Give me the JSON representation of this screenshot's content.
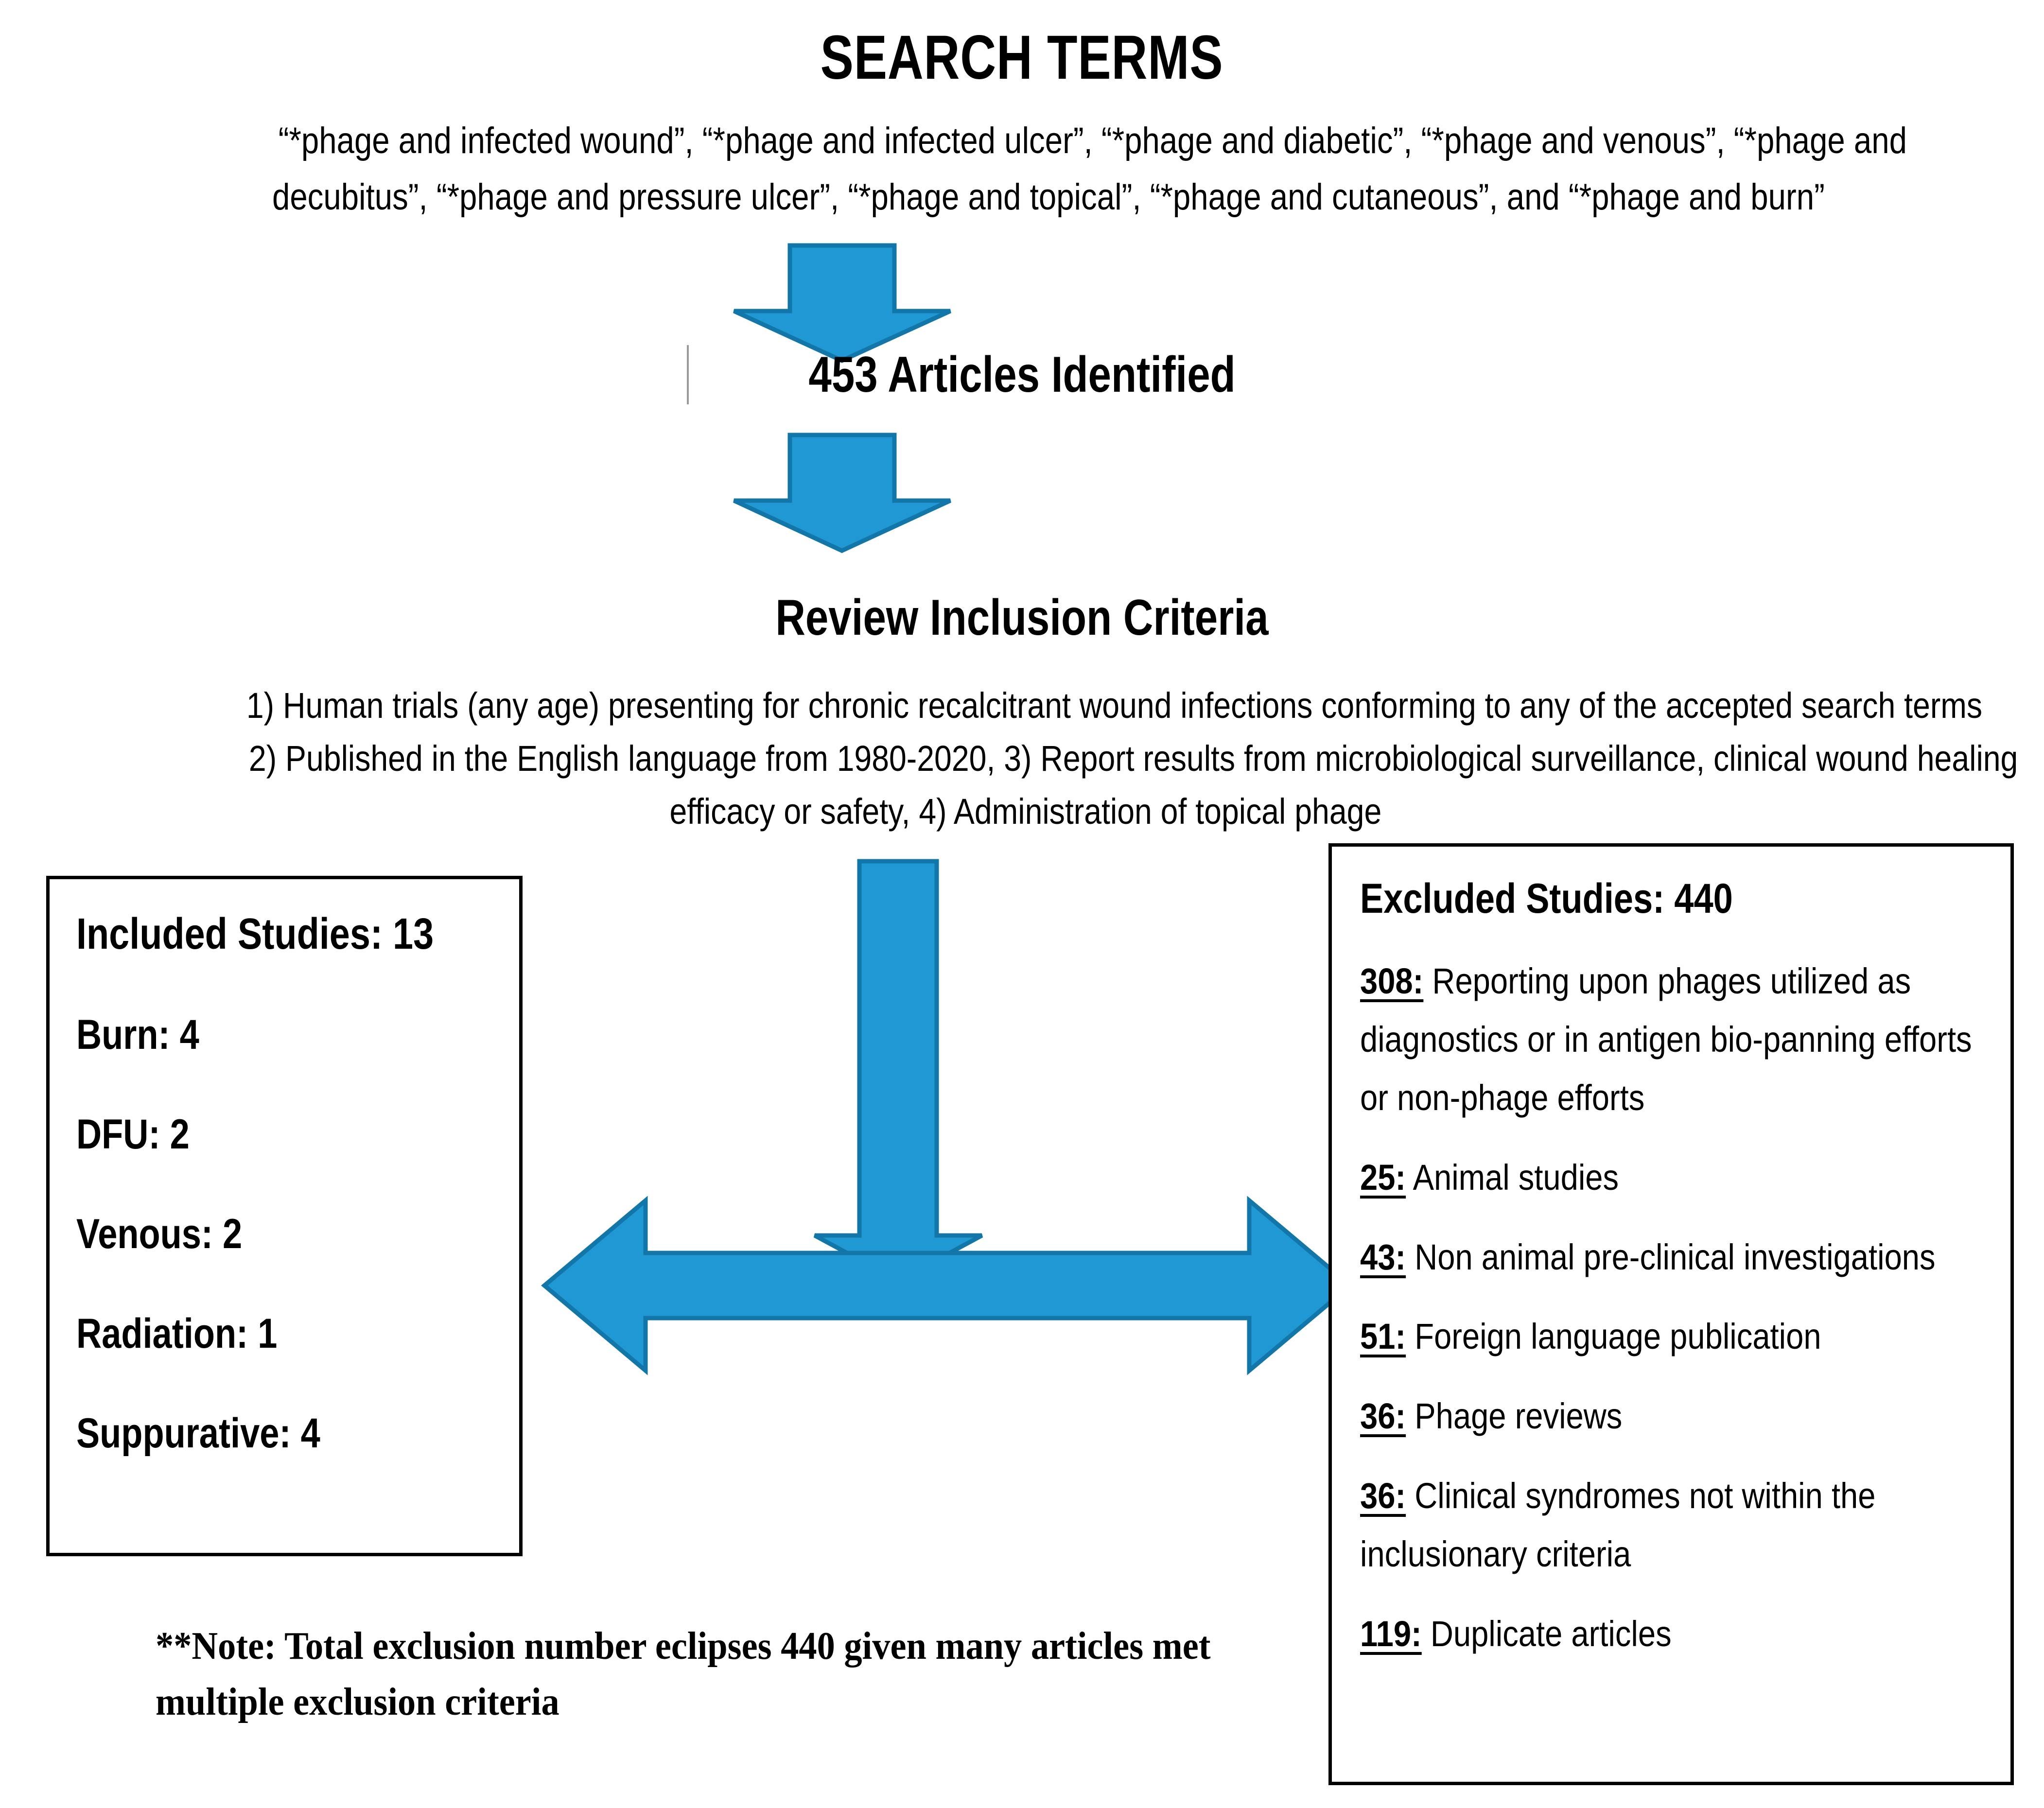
{
  "title": "SEARCH TERMS",
  "search_terms": {
    "line1": "“*phage and infected wound”, “*phage and infected ulcer”, “*phage and diabetic”, “*phage and venous”, “*phage and",
    "line2": "decubitus”, “*phage and pressure ulcer”, “*phage and topical”, “*phage and cutaneous”, and “*phage and burn”"
  },
  "articles_identified": "453 Articles Identified",
  "review_heading": "Review Inclusion Criteria",
  "criteria": {
    "line1": "1) Human trials (any age) presenting for chronic recalcitrant wound infections conforming to any of the accepted search terms",
    "line2": "2) Published in the English language from 1980-2020, 3) Report results from microbiological surveillance, clinical wound healing",
    "line3": "efficacy or safety, 4) Administration of topical phage"
  },
  "included": {
    "title": "Included Studies:  13",
    "rows": [
      "Burn:  4",
      "DFU:  2",
      "Venous:  2",
      "Radiation:  1",
      "Suppurative:  4"
    ]
  },
  "excluded": {
    "title": "Excluded Studies:  440",
    "rows": [
      {
        "num": "308:",
        "text": " Reporting upon phages utilized as diagnostics or in antigen bio-panning efforts or non-phage efforts"
      },
      {
        "num": "25:",
        "text": "  Animal studies"
      },
      {
        "num": "43:",
        "text": "  Non animal pre-clinical investigations"
      },
      {
        "num": "51:",
        "text": "  Foreign language publication"
      },
      {
        "num": "36:",
        "text": "  Phage reviews"
      },
      {
        "num": "36:",
        "text": "  Clinical syndromes not within the inclusionary criteria"
      },
      {
        "num": "119:",
        "text": "  Duplicate articles"
      }
    ]
  },
  "note": {
    "line1": "**Note: Total exclusion number eclipses 440 given many articles met",
    "line2": "multiple exclusion criteria"
  },
  "colors": {
    "arrow_fill": "#2098D4",
    "arrow_stroke": "#1277A8",
    "box_border": "#000000",
    "text": "#000000",
    "tick": "#9a9a9a"
  },
  "chart_data": {
    "type": "flowchart",
    "title": "SEARCH TERMS",
    "nodes": [
      {
        "id": "search",
        "label": "SEARCH TERMS",
        "value": null
      },
      {
        "id": "identified",
        "label": "453 Articles Identified",
        "value": 453
      },
      {
        "id": "criteria",
        "label": "Review Inclusion Criteria",
        "value": null
      },
      {
        "id": "included",
        "label": "Included Studies",
        "value": 13
      },
      {
        "id": "excluded",
        "label": "Excluded Studies",
        "value": 440
      }
    ],
    "edges": [
      {
        "from": "search",
        "to": "identified",
        "shape": "down-arrow"
      },
      {
        "from": "identified",
        "to": "criteria",
        "shape": "down-arrow"
      },
      {
        "from": "criteria",
        "to": "split",
        "shape": "down-arrow"
      },
      {
        "from": "included",
        "to": "excluded",
        "shape": "double-headed-horizontal-arrow"
      }
    ],
    "included_breakdown": {
      "categories": [
        "Burn",
        "DFU",
        "Venous",
        "Radiation",
        "Suppurative"
      ],
      "values": [
        4,
        2,
        2,
        1,
        4
      ],
      "total": 13
    },
    "excluded_breakdown": {
      "categories": [
        "Reporting upon phages utilized as diagnostics or in antigen bio-panning efforts or non-phage efforts",
        "Animal studies",
        "Non animal pre-clinical investigations",
        "Foreign language publication",
        "Phage reviews",
        "Clinical syndromes not within the inclusionary criteria",
        "Duplicate articles"
      ],
      "values": [
        308,
        25,
        43,
        51,
        36,
        36,
        119
      ],
      "total": 440,
      "note": "Total exclusion number eclipses 440 given many articles met multiple exclusion criteria"
    }
  }
}
